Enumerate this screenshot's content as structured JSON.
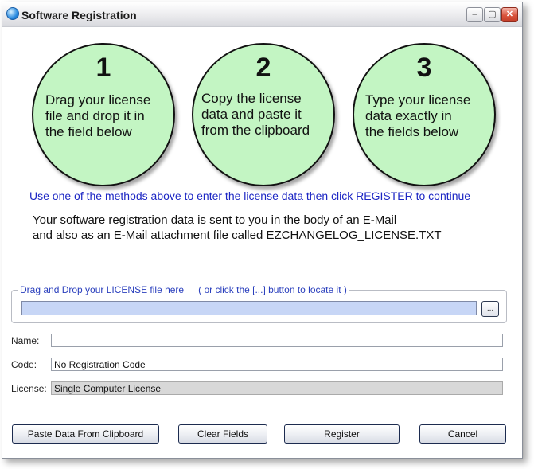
{
  "window": {
    "title": "Software Registration",
    "buttons": {
      "minimize": "–",
      "maximize": "▢",
      "close": "✕"
    }
  },
  "steps": [
    {
      "number": "1",
      "text": "Drag your license\nfile and drop it in\nthe field below"
    },
    {
      "number": "2",
      "text": "Copy the license\ndata and paste it\nfrom the clipboard"
    },
    {
      "number": "3",
      "text": "Type your license\ndata exactly in\nthe fields below"
    }
  ],
  "instructions": {
    "main": "Use one of the methods above to enter the license data then click REGISTER to continue",
    "line1": "Your software registration data is sent to you in the body of an E-Mail",
    "line2": "and also as an E-Mail attachment file called EZCHANGELOG_LICENSE.TXT"
  },
  "dropzone": {
    "label": "Drag and Drop your LICENSE file here",
    "hint": "( or click the [...] button to locate it )",
    "value": "",
    "browse_label": "..."
  },
  "fields": {
    "name": {
      "label": "Name:",
      "value": ""
    },
    "code": {
      "label": "Code:",
      "value": "No Registration Code"
    },
    "license": {
      "label": "License:",
      "value": "Single Computer License"
    }
  },
  "buttons": {
    "paste": "Paste Data From Clipboard",
    "clear": "Clear Fields",
    "register": "Register",
    "cancel": "Cancel"
  },
  "colors": {
    "circle_fill": "#c3f5c3",
    "note_blue": "#1d27c4",
    "drop_field": "#c7d6f6"
  }
}
